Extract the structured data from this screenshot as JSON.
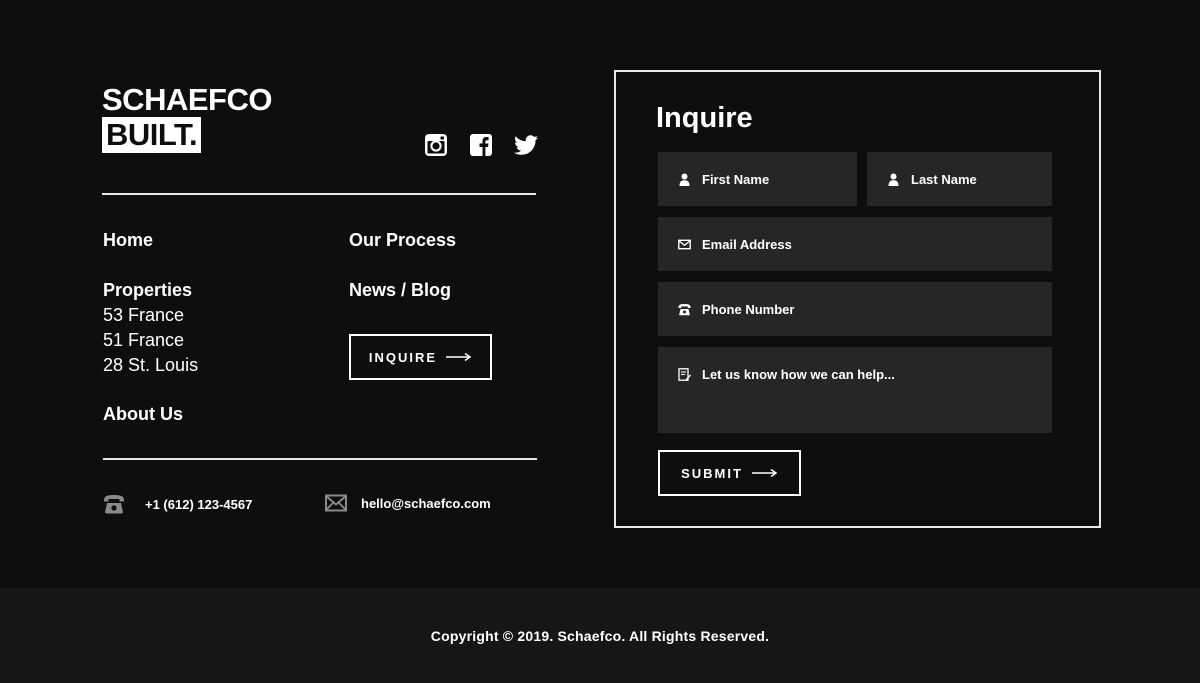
{
  "brand": {
    "logo_line1": "SCHAEFCO",
    "logo_line2": "BUILT."
  },
  "social": [
    "instagram-icon",
    "facebook-icon",
    "twitter-icon"
  ],
  "nav": {
    "home": "Home",
    "properties": "Properties",
    "properties_items": [
      "53 France",
      "51 France",
      "28 St. Louis"
    ],
    "about": "About Us",
    "process": "Our Process",
    "blog": "News / Blog",
    "inquire_button": "INQUIRE"
  },
  "contact": {
    "phone": "+1 (612) 123-4567",
    "email": "hello@schaefco.com"
  },
  "form": {
    "title": "Inquire",
    "first_name": "First Name",
    "last_name": "Last Name",
    "email": "Email Address",
    "phone": "Phone Number",
    "message": "Let us know how we can help...",
    "submit": "SUBMIT"
  },
  "footer": {
    "copyright": "Copyright © 2019. Schaefco. All Rights Reserved."
  },
  "colors": {
    "background": "#0e0e0e",
    "footer_bar": "#161616",
    "field": "#262626",
    "text": "#ffffff"
  }
}
